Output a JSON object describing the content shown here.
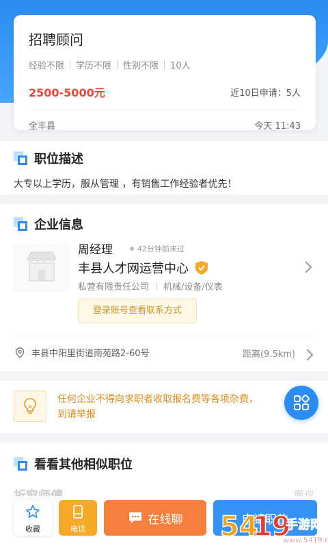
{
  "job": {
    "title": "招聘顾问",
    "tags": [
      "经验不限",
      "学历不限",
      "性别不限",
      "10人"
    ],
    "salary": "2500-5000元",
    "apply_count": "近10日申请：5人",
    "location": "全丰县",
    "posted_time": "今天 11:43"
  },
  "description": {
    "heading": "职位描述",
    "text": "大专以上学历，服从管理 ，有销售工作经验者优先！"
  },
  "company": {
    "heading": "企业信息",
    "contact_name": "周经理",
    "active_time": "42分钟前来过",
    "name": "丰县人才网运营中心",
    "type": "私营有限责任公司",
    "industry": "机械/设备/仪表",
    "login_prompt": "登录账号查看联系方式",
    "address": "丰县中阳里街道南苑路2-60号",
    "distance": "距离(9.5km)"
  },
  "warning": {
    "line1": "任何企业不得向求职者收取报名费等各项杂费，",
    "line2": "到请举报"
  },
  "similar": {
    "heading": "看看其他相似职位",
    "peek_title": "折窗师傅",
    "peek_right": "面议"
  },
  "bottom_bar": {
    "favorite_label": "收藏",
    "call_label": "电话",
    "chat_label": "在线聊",
    "apply_label": "申请职位"
  },
  "watermark": {
    "text": "5419手游网",
    "url": "www.5419.cn"
  },
  "colors": {
    "primary": "#2a8cf0",
    "salary": "#e8483c",
    "warning": "#d98b1a",
    "chat": "#f57f3c",
    "call": "#f7a928"
  }
}
